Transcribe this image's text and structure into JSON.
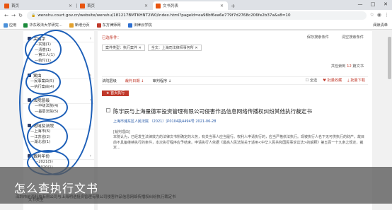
{
  "browser": {
    "tabs": [
      {
        "label": "首页",
        "active": false
      },
      {
        "label": "首页",
        "active": false
      },
      {
        "label": "文书列表",
        "active": true
      }
    ],
    "new_tab": "+",
    "window_controls": [
      "—",
      "□",
      "✕"
    ],
    "url": "wenshu.court.gov.cn/website/wenshu/181217BMTKHNT2W0/index.html?pageId=ea98bf6ea6e779f7d2768c206fe2b37a&s8=10",
    "bookmarks": [
      {
        "label": "应用",
        "color": "#4a90d9"
      },
      {
        "label": "华东政法大学研究...",
        "color": "#1a8a3a"
      },
      {
        "label": "新增分页",
        "color": "#e3a12d"
      },
      {
        "label": "东方律师网",
        "color": "#c0392b"
      },
      {
        "label": "法律云学院",
        "color": "#2d6fd1"
      }
    ],
    "reading_list": "阅读清单"
  },
  "sidebar": {
    "sections": [
      {
        "title": "关键字",
        "items": [
          "—实施(1)",
          "—清偿(1)",
          "—第三人(1)",
          "—给付(1)"
        ]
      },
      {
        "title": "案由",
        "items": [
          "—民事案由(5)",
          "—执行案由(4)"
        ]
      },
      {
        "title": "法院层级",
        "items": [
          "—中级法院(4)",
          "—基层法院(5)"
        ]
      },
      {
        "title": "地域及法院",
        "items": [
          "—上海市(6)",
          "—江苏省(2)",
          "—湖北省(1)"
        ]
      },
      {
        "title": "裁判年份",
        "items": [
          "—2021(5)",
          "—2020(1)"
        ]
      }
    ],
    "bottom_label": "文书类型"
  },
  "main": {
    "crumb_label": "已选条件：",
    "filters": [
      "案件类型：执行案件 ✕",
      "全文：上海司法律师事务所 ✕"
    ],
    "save_links": [
      "保存搜索条件",
      "清空搜索条件"
    ],
    "total_prefix": "共检索到",
    "total_count": "12",
    "total_suffix": "篇文书",
    "sort": [
      "法院层级",
      "裁判日期 ↓",
      "审判程序 ↓"
    ],
    "actions": [
      "全选",
      "批量收藏",
      "批量下载"
    ],
    "card": {
      "badge": "首页执行",
      "title": "陈宇辰与上海量德军投资管理有限公司侵害作品信息网络传播权纠纷其他执行裁定书",
      "meta": "上海市浦东区人民法院    （2021）沪0104执4494号    2021-06-28",
      "basis_label": "[裁判理由]",
      "body": "本院认为，已经发生法律效力的法律文书所确定的义务，有关当事人应当履行。权利人申请执行的，应当严格依法执行。现被执行人名下无可供执行的财产，故目前不具备继续执行的条件，本次执行程序应予结束。申请执行人依据《最高人民法院关于适用<中华人民共和国民事诉讼法>的解释》第五百一十九条之规定，裁定..."
    },
    "card2_title": "深圳市前海科技有限公司与上海明浩投资管理有限公司侵害作品信息网络传播权纠纷执行裁定书"
  },
  "caption": "怎么查执行文书"
}
